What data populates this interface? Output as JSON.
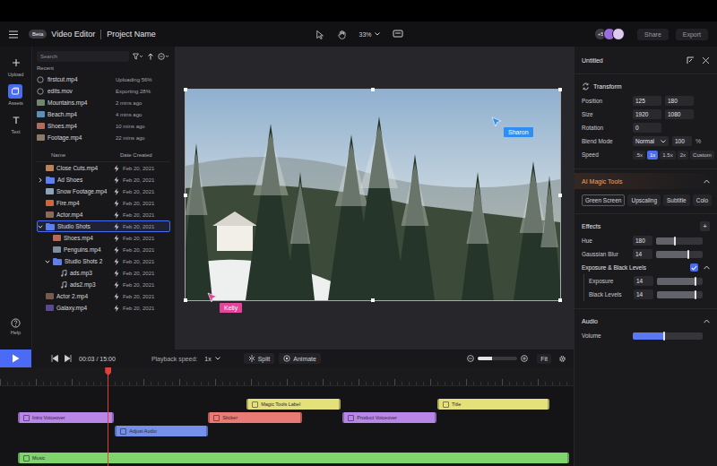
{
  "header": {
    "logo": "Beta",
    "app_title": "Video Editor",
    "project_name": "Project Name",
    "zoom": "33%",
    "extra_collaborators": "+5",
    "collaborators": [
      {
        "color": "#9b6be0"
      },
      {
        "color": "#dccbee"
      }
    ],
    "buttons": [
      "Share",
      "Export"
    ]
  },
  "rail": {
    "items": [
      {
        "label": "Upload",
        "selected": false
      },
      {
        "label": "Assets",
        "selected": true
      },
      {
        "label": "Text",
        "selected": false
      }
    ],
    "help": "Help"
  },
  "assets": {
    "search": {
      "placeholder": "Search"
    },
    "recent_title": "Recent",
    "recent": [
      {
        "name": "firstcut.mp4",
        "status": "Uploading 56%",
        "kind": "progress",
        "color": "#9a9aa0"
      },
      {
        "name": "edits.mov",
        "status": "Exporting 28%",
        "kind": "progress",
        "color": "#9a9aa0"
      },
      {
        "name": "Mountains.mp4",
        "status": "2 mins ago",
        "kind": "file",
        "color": "#6f8a6a"
      },
      {
        "name": "Beach.mp4",
        "status": "4 mins ago",
        "kind": "file",
        "color": "#5f8fb5"
      },
      {
        "name": "Shoes.mp4",
        "status": "10 mins ago",
        "kind": "file",
        "color": "#b56a5a"
      },
      {
        "name": "Footage.mp4",
        "status": "22 mins ago",
        "kind": "file",
        "color": "#8a7a6a"
      }
    ],
    "columns": [
      "Name",
      "Date Created"
    ],
    "files": [
      {
        "name": "Close Cuts.mp4",
        "date": "Feb 20, 2021",
        "kind": "file",
        "depth": 0,
        "selected": false,
        "color": "#b5845a"
      },
      {
        "name": "Ad Shoes",
        "date": "Feb 20, 2021",
        "kind": "folder",
        "depth": 0,
        "expanded": false,
        "selected": false,
        "color": "#5f7ff0"
      },
      {
        "name": "Snow Footage.mp4",
        "date": "Feb 20, 2021",
        "kind": "file",
        "depth": 0,
        "selected": false,
        "color": "#8fa3b5"
      },
      {
        "name": "Fire.mp4",
        "date": "Feb 20, 2021",
        "kind": "file",
        "depth": 0,
        "selected": false,
        "color": "#d0653a"
      },
      {
        "name": "Actor.mp4",
        "date": "Feb 20, 2021",
        "kind": "file",
        "depth": 0,
        "selected": false,
        "color": "#8a6a5a"
      },
      {
        "name": "Studio Shots",
        "date": "Feb 20, 2021",
        "kind": "folder",
        "depth": 0,
        "expanded": true,
        "selected": true,
        "color": "#5f7ff0"
      },
      {
        "name": "Shoes.mp4",
        "date": "Feb 20, 2021",
        "kind": "file",
        "depth": 1,
        "selected": false,
        "color": "#b56a5a"
      },
      {
        "name": "Penguins.mp4",
        "date": "Feb 20, 2021",
        "kind": "file",
        "depth": 1,
        "selected": false,
        "color": "#7a8fa0"
      },
      {
        "name": "Studio Shots 2",
        "date": "Feb 20, 2021",
        "kind": "folder",
        "depth": 1,
        "expanded": true,
        "selected": false,
        "color": "#5f7ff0"
      },
      {
        "name": "ads.mp3",
        "date": "Feb 20, 2021",
        "kind": "audio",
        "depth": 2,
        "selected": false,
        "color": "#b0b0b8"
      },
      {
        "name": "ads2.mp3",
        "date": "Feb 20, 2021",
        "kind": "audio",
        "depth": 2,
        "selected": false,
        "color": "#b0b0b8"
      },
      {
        "name": "Actor 2.mp4",
        "date": "Feb 20, 2021",
        "kind": "file",
        "depth": 0,
        "selected": false,
        "color": "#7a5a4a"
      },
      {
        "name": "Galaxy.mp4",
        "date": "Feb 20, 2021",
        "kind": "file",
        "depth": 0,
        "selected": false,
        "color": "#5a4a8a"
      }
    ]
  },
  "canvas": {
    "cursors": [
      {
        "name": "Sharon",
        "color": "#2f8ef0"
      },
      {
        "name": "Kelly",
        "color": "#e0469a"
      }
    ]
  },
  "inspector": {
    "title": "Untitled",
    "transform": {
      "title": "Transform",
      "rows": [
        {
          "label": "Position",
          "kind": "pair",
          "values": [
            "125",
            "180"
          ]
        },
        {
          "label": "Size",
          "kind": "pair",
          "values": [
            "1920",
            "1080"
          ]
        },
        {
          "label": "Rotation",
          "kind": "single",
          "values": [
            "0"
          ]
        },
        {
          "label": "Blend Mode",
          "kind": "blend",
          "values": [
            "Normal",
            "100"
          ],
          "unit": "%"
        }
      ],
      "speed": {
        "label": "Speed",
        "options": [
          {
            "label": ".5x",
            "selected": false
          },
          {
            "label": "1x",
            "selected": true
          },
          {
            "label": "1.5x",
            "selected": false
          },
          {
            "label": "2x",
            "selected": false
          },
          {
            "label": "Custom",
            "selected": false
          }
        ]
      }
    },
    "ai_tools": {
      "title": "AI Magic Tools",
      "expanded": true,
      "tools": [
        {
          "label": "Green Screen",
          "selected": true,
          "badge": false
        },
        {
          "label": "Upscaling",
          "selected": false,
          "badge": true
        },
        {
          "label": "Subtitle",
          "selected": false,
          "badge": true
        },
        {
          "label": "Colo",
          "selected": false,
          "badge": true
        }
      ]
    },
    "effects": {
      "title": "Effects",
      "add": "+",
      "sliders": [
        {
          "label": "Hue",
          "value": "180",
          "level": 0.4
        },
        {
          "label": "Gaussian Blur",
          "value": "14",
          "level": 0.7
        }
      ],
      "group": {
        "label": "Exposure & Black Levels",
        "on": true,
        "expanded": true,
        "sliders": [
          {
            "label": "Exposure",
            "value": "14",
            "level": 0.85
          },
          {
            "label": "Black Levels",
            "value": "14",
            "level": 0.85
          }
        ]
      }
    },
    "audio": {
      "title": "Audio",
      "expanded": true,
      "sliders": [
        {
          "label": "Volume",
          "level": 0.45
        }
      ]
    }
  },
  "timeline": {
    "time": "00:03 / 15:00",
    "speed_label": "Playback speed:",
    "speed": "1x",
    "actions": [
      "Split",
      "Animate"
    ],
    "zoom": {
      "level": 0.35
    },
    "fit": "Fit",
    "playhead": {
      "level": 0.163
    },
    "tracks": [
      {
        "clips": [
          {
            "label": "Magic Tools Label",
            "color": "#e4e07a",
            "start": 0.415,
            "end": 0.585
          },
          {
            "label": "Title",
            "color": "#e4e07a",
            "start": 0.761,
            "end": 0.964
          }
        ]
      },
      {
        "clips": [
          {
            "label": "Intro Voiceover",
            "color": "#b886e6",
            "start": 0,
            "end": 0.174
          },
          {
            "label": "Sticker",
            "color": "#ea7a74",
            "start": 0.345,
            "end": 0.515
          },
          {
            "label": "Product Voiceover",
            "color": "#b886e6",
            "start": 0.589,
            "end": 0.76
          }
        ]
      },
      {
        "clips": [
          {
            "label": "Adjust Audio",
            "color": "#7590ea",
            "start": 0.176,
            "end": 0.345
          }
        ]
      },
      {
        "clips": []
      },
      {
        "clips": [
          {
            "label": "Music",
            "color": "#7fd46c",
            "start": 0,
            "end": 1
          }
        ]
      }
    ]
  }
}
